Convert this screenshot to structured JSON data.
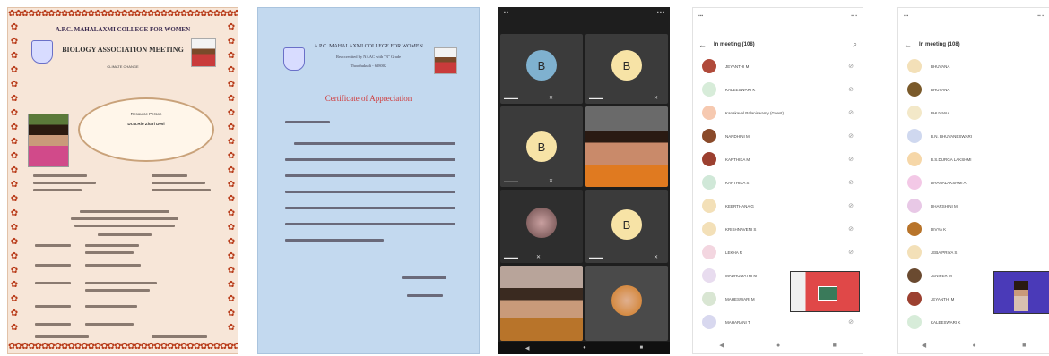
{
  "invitation": {
    "college": "A.P.C. MAHALAXMI COLLEGE FOR WOMEN",
    "event": "BIOLOGY ASSOCIATION MEETING",
    "program_title": "CLIMATE CHANGE",
    "speaker_label": "Resource Person",
    "speaker_name": "Dr.M.Rio Zhari Devi"
  },
  "certificate": {
    "college": "A.P.C. MAHALAXMI COLLEGE FOR WOMEN",
    "accreditation": "Reaccredited by NAAC with \"B\" Grade",
    "city": "Thoothukudi - 628002",
    "heading": "Certificate of Appreciation"
  },
  "meet": {
    "tiles": [
      {
        "avatar": "B",
        "color": "#7fb1cf"
      },
      {
        "avatar": "B",
        "color": "#f7e3a6"
      },
      {
        "avatar": "B",
        "color": "#f7e3a6"
      },
      {
        "avatar": "B",
        "color": "#f7e3a6"
      }
    ]
  },
  "participants_a": {
    "title": "In meeting (108)",
    "rows": [
      {
        "name": "JEYANTHI M",
        "color": "#b04a3a"
      },
      {
        "name": "KALEESWARI K",
        "color": "#d7ecd9"
      },
      {
        "name": "Kanakavel Palaniswamy (Guest)",
        "color": "#f6c9b0"
      },
      {
        "name": "NANDHINI M",
        "color": "#8a4a2a"
      },
      {
        "name": "KARTHIKA M",
        "color": "#9c4030"
      },
      {
        "name": "KARTHIKA S",
        "color": "#d0e8d8"
      },
      {
        "name": "KEERTHANA G",
        "color": "#f3e0b8"
      },
      {
        "name": "KRISHNAVENI S",
        "color": "#f3e0b8"
      },
      {
        "name": "LEKHA R",
        "color": "#f3d6e0"
      },
      {
        "name": "MADHUMATHI M",
        "color": "#e8dcef"
      },
      {
        "name": "MAHESWARI M",
        "color": "#d9e6d3"
      },
      {
        "name": "MAHARANI T",
        "color": "#d8d8ef"
      }
    ]
  },
  "participants_b": {
    "title": "In meeting (108)",
    "rows": [
      {
        "name": "BHUVANA",
        "color": "#f3e0b8"
      },
      {
        "name": "BHUVANA",
        "color": "#7a5a2a"
      },
      {
        "name": "BHUVANA",
        "color": "#f3e8c8"
      },
      {
        "name": "B.N. BHUVANESWARI",
        "color": "#cfd8ef"
      },
      {
        "name": "B.S.DURGA LAKSHMI",
        "color": "#f6d7a8"
      },
      {
        "name": "DHANALAKSHMI A",
        "color": "#f3c8e6"
      },
      {
        "name": "DHARSHINI M",
        "color": "#e8c8e6"
      },
      {
        "name": "DIVYA K",
        "color": "#b8742a"
      },
      {
        "name": "JEBA PRIYA S",
        "color": "#f3e0b8"
      },
      {
        "name": "JENIFER M",
        "color": "#6a4a30"
      },
      {
        "name": "JEYANTHI M",
        "color": "#9c4030"
      },
      {
        "name": "KALEESWARI K",
        "color": "#d7ecd9"
      }
    ]
  }
}
